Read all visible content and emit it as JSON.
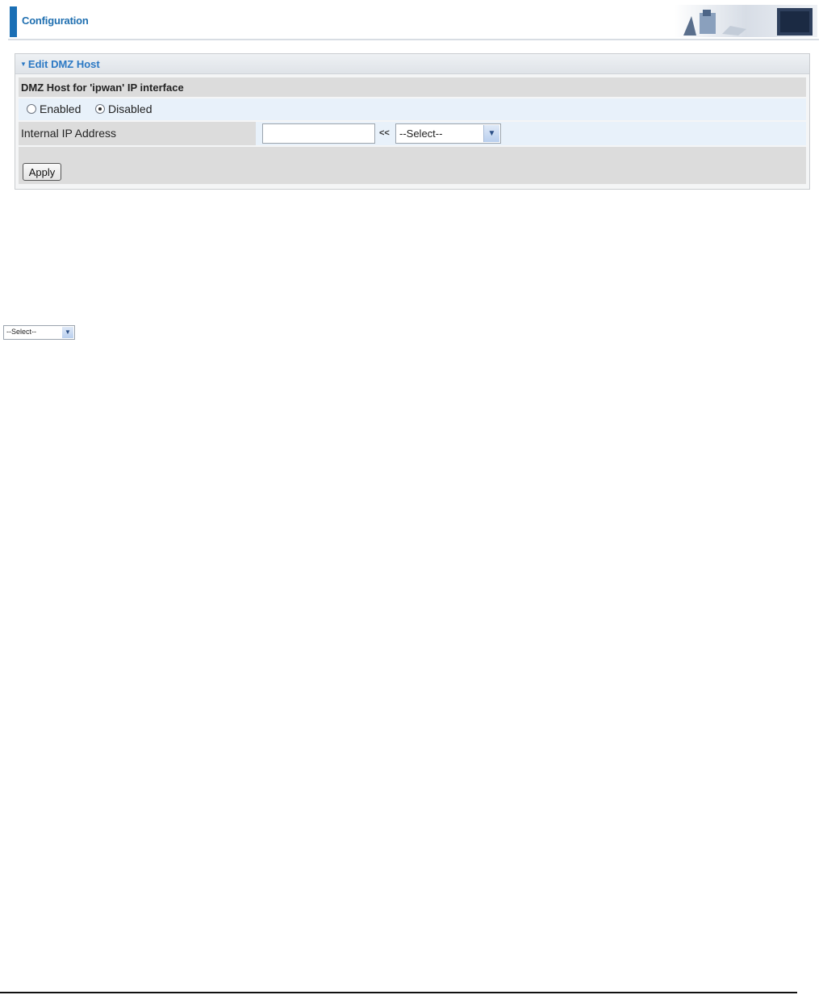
{
  "header": {
    "title": "Configuration",
    "graphic_icon": "network-devices-banner"
  },
  "panel": {
    "title": "Edit DMZ Host",
    "arrow_icon": "triangle-down-icon",
    "section_heading": "DMZ Host for 'ipwan' IP interface",
    "options": {
      "enabled_label": "Enabled",
      "disabled_label": "Disabled",
      "selected": "Disabled"
    },
    "ip_row": {
      "label": "Internal IP Address",
      "value": "",
      "arrow": "<<",
      "select_value": "--Select--"
    },
    "apply_label": "Apply"
  },
  "thumbnail_select": {
    "value": "--Select--"
  },
  "colors": {
    "accent": "#1f6fb0",
    "panel_title": "#2c79c4",
    "row_highlight": "#e8f1fa",
    "row_gray": "#dcdcdc"
  }
}
